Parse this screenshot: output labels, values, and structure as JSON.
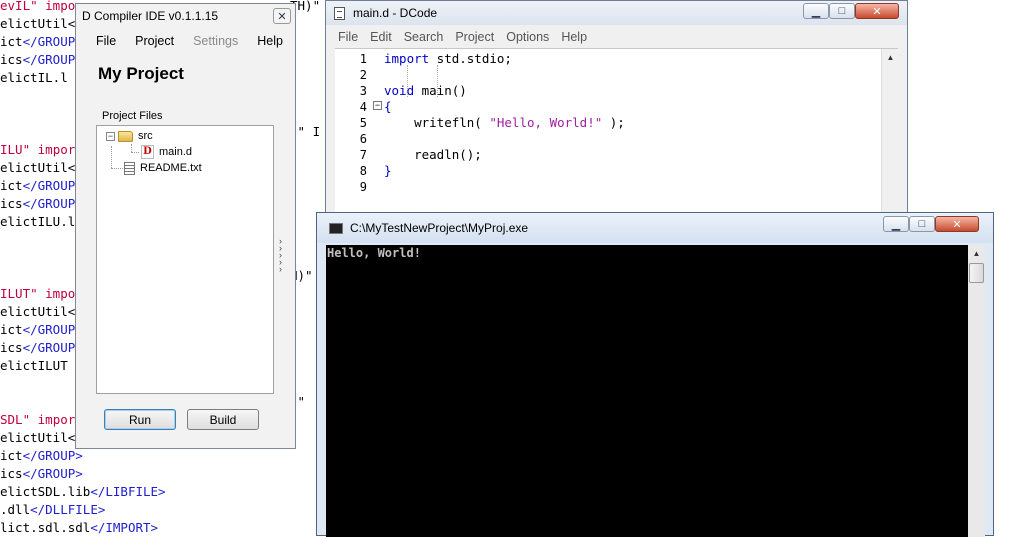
{
  "background_code": [
    [
      {
        "t": "evIL\" ",
        "c": "red"
      },
      {
        "t": "impo",
        "c": "red"
      }
    ],
    [
      {
        "t": "elictUtil<",
        "c": "black"
      }
    ],
    [
      {
        "t": "ict",
        "c": "black"
      },
      {
        "t": "</GROUP",
        "c": "blue"
      }
    ],
    [
      {
        "t": "ics",
        "c": "black"
      },
      {
        "t": "</GROUP",
        "c": "blue"
      }
    ],
    [
      {
        "t": "elictIL.l",
        "c": "black"
      }
    ],
    [],
    [],
    [],
    [
      {
        "t": "ILU\" ",
        "c": "red"
      },
      {
        "t": "impor",
        "c": "red"
      }
    ],
    [
      {
        "t": "elictUtil<",
        "c": "black"
      }
    ],
    [
      {
        "t": "ict",
        "c": "black"
      },
      {
        "t": "</GROUP",
        "c": "blue"
      }
    ],
    [
      {
        "t": "ics",
        "c": "black"
      },
      {
        "t": "</GROUP",
        "c": "blue"
      }
    ],
    [
      {
        "t": "elictILU.l",
        "c": "black"
      }
    ],
    [],
    [],
    [],
    [
      {
        "t": "ILUT\" ",
        "c": "red"
      },
      {
        "t": "impo",
        "c": "red"
      }
    ],
    [
      {
        "t": "elictUtil<",
        "c": "black"
      }
    ],
    [
      {
        "t": "ict",
        "c": "black"
      },
      {
        "t": "</GROUP",
        "c": "blue"
      }
    ],
    [
      {
        "t": "ics",
        "c": "black"
      },
      {
        "t": "</GROUP",
        "c": "blue"
      }
    ],
    [
      {
        "t": "elictILUT",
        "c": "black"
      }
    ],
    [],
    [],
    [
      {
        "t": "SDL\" ",
        "c": "red"
      },
      {
        "t": "impor",
        "c": "red"
      }
    ],
    [
      {
        "t": "elictUtil<",
        "c": "black"
      }
    ],
    [
      {
        "t": "ict",
        "c": "black"
      },
      {
        "t": "</GROUP>",
        "c": "blue"
      }
    ],
    [
      {
        "t": "ics",
        "c": "black"
      },
      {
        "t": "</GROUP>",
        "c": "blue"
      }
    ],
    [
      {
        "t": "elictSDL.lib",
        "c": "black"
      },
      {
        "t": "</LIBFILE>",
        "c": "blue"
      }
    ],
    [
      {
        "t": ".dll",
        "c": "black"
      },
      {
        "t": "</DLLFILE>",
        "c": "blue"
      }
    ],
    [
      {
        "t": "lict.sdl.sdl",
        "c": "black"
      },
      {
        "t": "</IMPORT>",
        "c": "blue"
      }
    ]
  ],
  "background_code_right": [
    {
      "row": 1,
      "t": "TH)\""
    },
    {
      "row": 8,
      "t": ")\" I"
    },
    {
      "row": 16,
      "t": "H)\""
    },
    {
      "row": 23,
      "t": ")\""
    }
  ],
  "ide": {
    "title": "D Compiler IDE v0.1.1.15",
    "menu": [
      {
        "label": "File",
        "disabled": false
      },
      {
        "label": "Project",
        "disabled": false
      },
      {
        "label": "Settings",
        "disabled": true
      },
      {
        "label": "Help",
        "disabled": false
      }
    ],
    "project_name": "My Project",
    "files_label": "Project Files",
    "tree": {
      "folder": "src",
      "folder_expander": "−",
      "file_in_folder": "main.d",
      "file_icon_letter": "D",
      "root_file": "README.txt"
    },
    "run_label": "Run",
    "build_label": "Build"
  },
  "dcode": {
    "title": "main.d - DCode",
    "menu": [
      "File",
      "Edit",
      "Search",
      "Project",
      "Options",
      "Help"
    ],
    "line_numbers": [
      "1",
      "2",
      "3",
      "4",
      "5",
      "6",
      "7",
      "8",
      "9"
    ],
    "code": [
      [
        {
          "t": "import",
          "k": "kw"
        },
        {
          "t": " std.stdio;",
          "k": ""
        }
      ],
      [],
      [
        {
          "t": "void",
          "k": "kw"
        },
        {
          "t": " main()",
          "k": ""
        }
      ],
      [
        {
          "t": "{",
          "k": "kw"
        }
      ],
      [
        {
          "t": "    writefln( ",
          "k": ""
        },
        {
          "t": "\"Hello, World!\"",
          "k": "str"
        },
        {
          "t": " );",
          "k": ""
        }
      ],
      [],
      [
        {
          "t": "    readln();",
          "k": ""
        }
      ],
      [
        {
          "t": "}",
          "k": "kw"
        }
      ],
      []
    ],
    "fold_marker": "−"
  },
  "console": {
    "title": "C:\\MyTestNewProject\\MyProj.exe",
    "output": "Hello, World!"
  },
  "controls": {
    "minimize": "▁",
    "maximize": "□",
    "close": "✕"
  }
}
